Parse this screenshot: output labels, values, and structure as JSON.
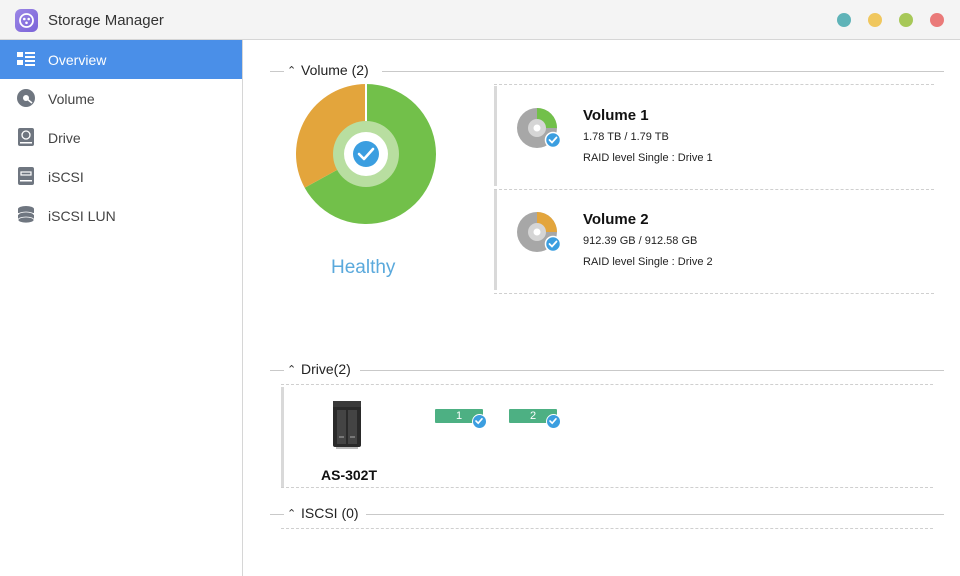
{
  "window": {
    "title": "Storage Manager",
    "controls": [
      {
        "name": "minimize",
        "color": "#5fb3b8"
      },
      {
        "name": "restore",
        "color": "#f0c75e"
      },
      {
        "name": "maximize",
        "color": "#a7c858"
      },
      {
        "name": "close",
        "color": "#ea7a79"
      }
    ]
  },
  "sidebar": {
    "items": [
      {
        "label": "Overview",
        "icon": "overview-list-icon",
        "active": true
      },
      {
        "label": "Volume",
        "icon": "volume-disk-icon",
        "active": false
      },
      {
        "label": "Drive",
        "icon": "drive-icon",
        "active": false
      },
      {
        "label": "iSCSI",
        "icon": "iscsi-icon",
        "active": false
      },
      {
        "label": "iSCSI LUN",
        "icon": "iscsi-lun-stack-icon",
        "active": false
      }
    ]
  },
  "overview": {
    "volume_section": {
      "title": "Volume (2)",
      "status": "Healthy",
      "usage_chart": {
        "used_fraction": 0.67,
        "free_fraction": 0.33,
        "used_color": "#72c04a",
        "free_color": "#e3a53c"
      },
      "volumes": [
        {
          "name": "Volume 1",
          "size": "1.78 TB / 1.79 TB",
          "raid": "RAID level Single : Drive 1",
          "fill_color": "#72c04a"
        },
        {
          "name": "Volume 2",
          "size": "912.39 GB / 912.58 GB",
          "raid": "RAID level Single : Drive 2",
          "fill_color": "#e3a53c"
        }
      ]
    },
    "drive_section": {
      "title": "Drive(2)",
      "device": "AS-302T",
      "disks": [
        {
          "label": "1"
        },
        {
          "label": "2"
        }
      ]
    },
    "iscsi_section": {
      "title": "ISCSI (0)"
    }
  },
  "colors": {
    "accent": "#4a8fe8",
    "healthy_text": "#5aa9dc",
    "check": "#3b9ee0",
    "disk_tag": "#4db083"
  }
}
